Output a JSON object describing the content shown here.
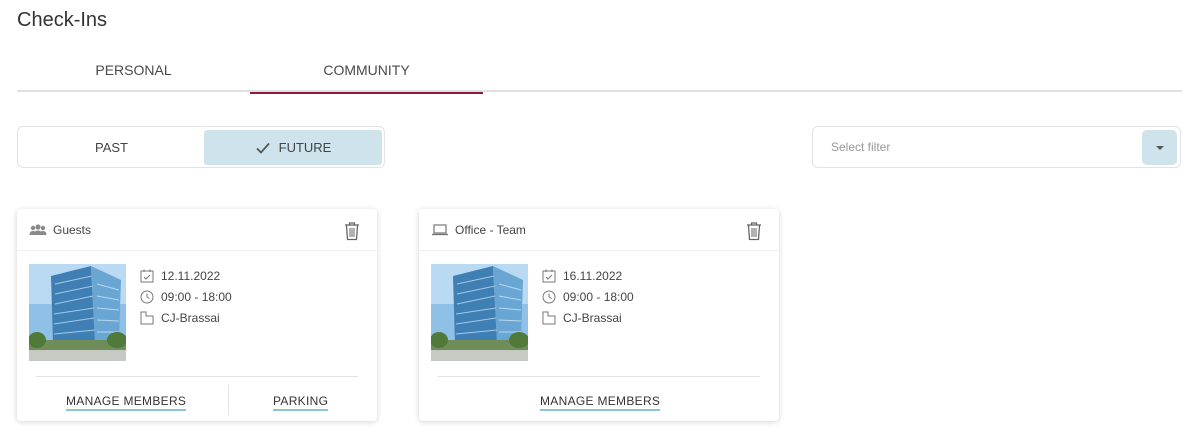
{
  "page": {
    "title": "Check-Ins"
  },
  "tabs": [
    {
      "label": "PERSONAL",
      "active": false
    },
    {
      "label": "COMMUNITY",
      "active": true
    }
  ],
  "time_toggle": {
    "past_label": "PAST",
    "future_label": "FUTURE",
    "selected": "FUTURE"
  },
  "filter": {
    "placeholder": "Select filter"
  },
  "colors": {
    "active_tab_underline": "#8b1b3f",
    "selected_toggle_bg": "#cfe3ec",
    "action_underline": "#8cc2dc"
  },
  "cards": [
    {
      "icon": "group-icon",
      "title": "Guests",
      "date": "12.11.2022",
      "time": "09:00 - 18:00",
      "location": "CJ-Brassai",
      "actions": [
        "MANAGE MEMBERS",
        "PARKING"
      ]
    },
    {
      "icon": "laptop-icon",
      "title": "Office - Team",
      "date": "16.11.2022",
      "time": "09:00 - 18:00",
      "location": "CJ-Brassai",
      "actions": [
        "MANAGE MEMBERS"
      ]
    }
  ]
}
